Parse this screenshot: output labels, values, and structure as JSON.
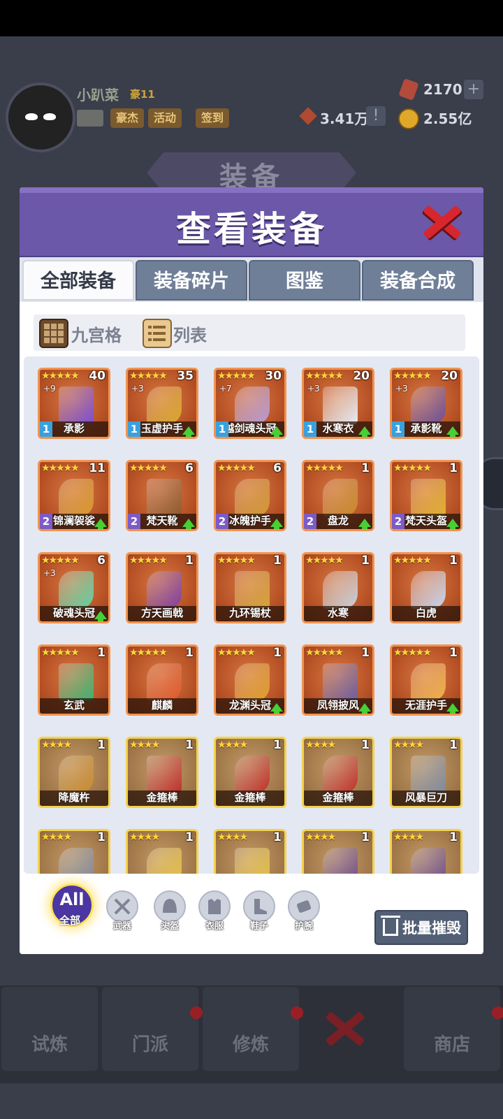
{
  "hud": {
    "player_name": "小趴菜",
    "rank": "豪11",
    "buttons": [
      "豪杰",
      "活动",
      "签到"
    ],
    "gems": "2170",
    "power": "3.41万",
    "gold": "2.55亿",
    "section_title": "装备"
  },
  "dialog": {
    "title": "查看装备",
    "tabs": [
      "全部装备",
      "装备碎片",
      "图鉴",
      "装备合成"
    ],
    "active_tab": "全部装备",
    "views": [
      "九宫格",
      "列表"
    ],
    "filters": {
      "all_top": "All",
      "all_bottom": "全部",
      "weapon": "武器",
      "helmet": "头盔",
      "clothes": "衣服",
      "shoes": "鞋子",
      "bracer": "护腕"
    },
    "bulk_destroy": "批量摧毁"
  },
  "items": [
    {
      "stars": "★★★★★",
      "count": "40",
      "level": "+9",
      "tier": "1",
      "name": "承影",
      "upgrade": false,
      "rarity": "orange"
    },
    {
      "stars": "★★★★★",
      "count": "35",
      "level": "+3",
      "tier": "1",
      "name": "玉虚护手",
      "upgrade": true,
      "rarity": "orange"
    },
    {
      "stars": "★★★★★",
      "count": "30",
      "level": "+7",
      "tier": "1",
      "name": "越剑魂头冠",
      "upgrade": true,
      "rarity": "orange"
    },
    {
      "stars": "★★★★★",
      "count": "20",
      "level": "+3",
      "tier": "1",
      "name": "水寒衣",
      "upgrade": true,
      "rarity": "orange"
    },
    {
      "stars": "★★★★★",
      "count": "20",
      "level": "+3",
      "tier": "1",
      "name": "承影靴",
      "upgrade": true,
      "rarity": "orange"
    },
    {
      "stars": "★★★★★",
      "count": "11",
      "level": "",
      "tier": "2",
      "name": "锦澜袈裟",
      "upgrade": true,
      "rarity": "orange"
    },
    {
      "stars": "★★★★★",
      "count": "6",
      "level": "",
      "tier": "2",
      "name": "梵天靴",
      "upgrade": true,
      "rarity": "orange"
    },
    {
      "stars": "★★★★★",
      "count": "6",
      "level": "",
      "tier": "2",
      "name": "冰魄护手",
      "upgrade": true,
      "rarity": "orange"
    },
    {
      "stars": "★★★★★",
      "count": "1",
      "level": "",
      "tier": "2",
      "name": "盘龙",
      "upgrade": true,
      "rarity": "orange"
    },
    {
      "stars": "★★★★★",
      "count": "1",
      "level": "",
      "tier": "2",
      "name": "梵天头盔",
      "upgrade": true,
      "rarity": "orange"
    },
    {
      "stars": "★★★★★",
      "count": "6",
      "level": "+3",
      "tier": "",
      "name": "破魂头冠",
      "upgrade": true,
      "rarity": "orange"
    },
    {
      "stars": "★★★★★",
      "count": "1",
      "level": "",
      "tier": "",
      "name": "方天画戟",
      "upgrade": false,
      "rarity": "orange"
    },
    {
      "stars": "★★★★★",
      "count": "1",
      "level": "",
      "tier": "",
      "name": "九环锡杖",
      "upgrade": false,
      "rarity": "orange"
    },
    {
      "stars": "★★★★★",
      "count": "1",
      "level": "",
      "tier": "",
      "name": "水寒",
      "upgrade": false,
      "rarity": "orange"
    },
    {
      "stars": "★★★★★",
      "count": "1",
      "level": "",
      "tier": "",
      "name": "白虎",
      "upgrade": false,
      "rarity": "orange"
    },
    {
      "stars": "★★★★★",
      "count": "1",
      "level": "",
      "tier": "",
      "name": "玄武",
      "upgrade": false,
      "rarity": "orange"
    },
    {
      "stars": "★★★★★",
      "count": "1",
      "level": "",
      "tier": "",
      "name": "麒麟",
      "upgrade": false,
      "rarity": "orange"
    },
    {
      "stars": "★★★★★",
      "count": "1",
      "level": "",
      "tier": "",
      "name": "龙渊头冠",
      "upgrade": true,
      "rarity": "orange"
    },
    {
      "stars": "★★★★★",
      "count": "1",
      "level": "",
      "tier": "",
      "name": "凤翎披风",
      "upgrade": true,
      "rarity": "orange"
    },
    {
      "stars": "★★★★★",
      "count": "1",
      "level": "",
      "tier": "",
      "name": "无涯护手",
      "upgrade": true,
      "rarity": "orange"
    },
    {
      "stars": "★★★★",
      "count": "1",
      "level": "",
      "tier": "",
      "name": "降魔杵",
      "upgrade": false,
      "rarity": "yellow"
    },
    {
      "stars": "★★★★",
      "count": "1",
      "level": "",
      "tier": "",
      "name": "金箍棒",
      "upgrade": false,
      "rarity": "yellow"
    },
    {
      "stars": "★★★★",
      "count": "1",
      "level": "",
      "tier": "",
      "name": "金箍棒",
      "upgrade": false,
      "rarity": "yellow"
    },
    {
      "stars": "★★★★",
      "count": "1",
      "level": "",
      "tier": "",
      "name": "金箍棒",
      "upgrade": false,
      "rarity": "yellow"
    },
    {
      "stars": "★★★★",
      "count": "1",
      "level": "",
      "tier": "",
      "name": "风暴巨刀",
      "upgrade": false,
      "rarity": "yellow"
    },
    {
      "stars": "★★★★",
      "count": "1",
      "level": "",
      "tier": "",
      "name": "",
      "upgrade": false,
      "rarity": "yellow"
    },
    {
      "stars": "★★★★",
      "count": "1",
      "level": "",
      "tier": "",
      "name": "",
      "upgrade": false,
      "rarity": "yellow"
    },
    {
      "stars": "★★★★",
      "count": "1",
      "level": "",
      "tier": "",
      "name": "",
      "upgrade": false,
      "rarity": "yellow"
    },
    {
      "stars": "★★★★",
      "count": "1",
      "level": "",
      "tier": "",
      "name": "",
      "upgrade": false,
      "rarity": "yellow"
    },
    {
      "stars": "★★★★",
      "count": "1",
      "level": "",
      "tier": "",
      "name": "",
      "upgrade": false,
      "rarity": "yellow"
    }
  ],
  "nav": [
    "试炼",
    "门派",
    "修炼",
    "商店"
  ],
  "colors": {
    "panel_header": "#6b58a8",
    "orange_frame": "#f09450",
    "yellow_frame": "#f2d24e",
    "upgrade_arrow": "#49cf36",
    "close": "#d8262e"
  }
}
